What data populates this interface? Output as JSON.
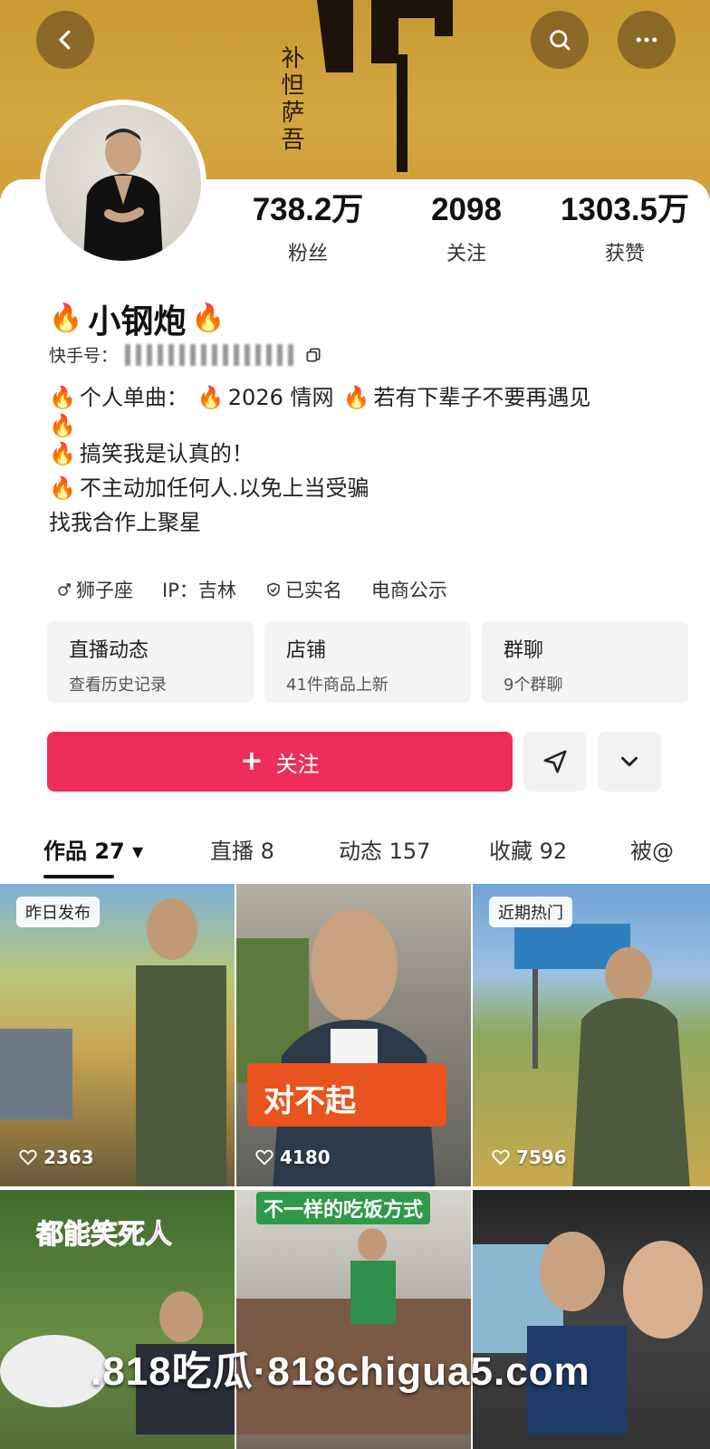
{
  "banner": {
    "calligraphy_small": "补怛萨吾"
  },
  "stats": [
    {
      "value": "738.2万",
      "label": "粉丝"
    },
    {
      "value": "2098",
      "label": "关注"
    },
    {
      "value": "1303.5万",
      "label": "获赞"
    }
  ],
  "profile": {
    "name": "小钢炮",
    "kuaishou_label": "快手号："
  },
  "bio": {
    "line1_a": "个人单曲：",
    "line1_b": "2026 情网",
    "line1_c": "若有下辈子不要再遇见",
    "line3": "搞笑我是认真的！",
    "line4": "不主动加任何人.以免上当受骗",
    "line5": "找我合作上聚星"
  },
  "tags": {
    "zodiac": "狮子座",
    "ip": "IP：吉林",
    "verified": "已实名",
    "ecommerce": "电商公示"
  },
  "quick": [
    {
      "title": "直播动态",
      "sub": "查看历史记录"
    },
    {
      "title": "店铺",
      "sub": "41件商品上新"
    },
    {
      "title": "群聊",
      "sub": "9个群聊"
    }
  ],
  "actions": {
    "follow_label": "关注",
    "follow_plus": "+"
  },
  "tabs": [
    {
      "label": "作品 27 ▾"
    },
    {
      "label": "直播 8"
    },
    {
      "label": "动态 157"
    },
    {
      "label": "收藏 92"
    },
    {
      "label": "被@"
    }
  ],
  "tiles": [
    {
      "badge": "昨日发布",
      "likes": "2363"
    },
    {
      "caption": "对不起",
      "likes": "4180"
    },
    {
      "badge": "近期热门",
      "likes": "7596"
    },
    {
      "caption": "都能笑死人"
    },
    {
      "caption": "不一样的吃饭方式"
    },
    {}
  ],
  "watermark": ".818吃瓜·818chigua5.com",
  "colors": {
    "accent": "#ee2d5b",
    "banner": "#cf9f3a"
  }
}
